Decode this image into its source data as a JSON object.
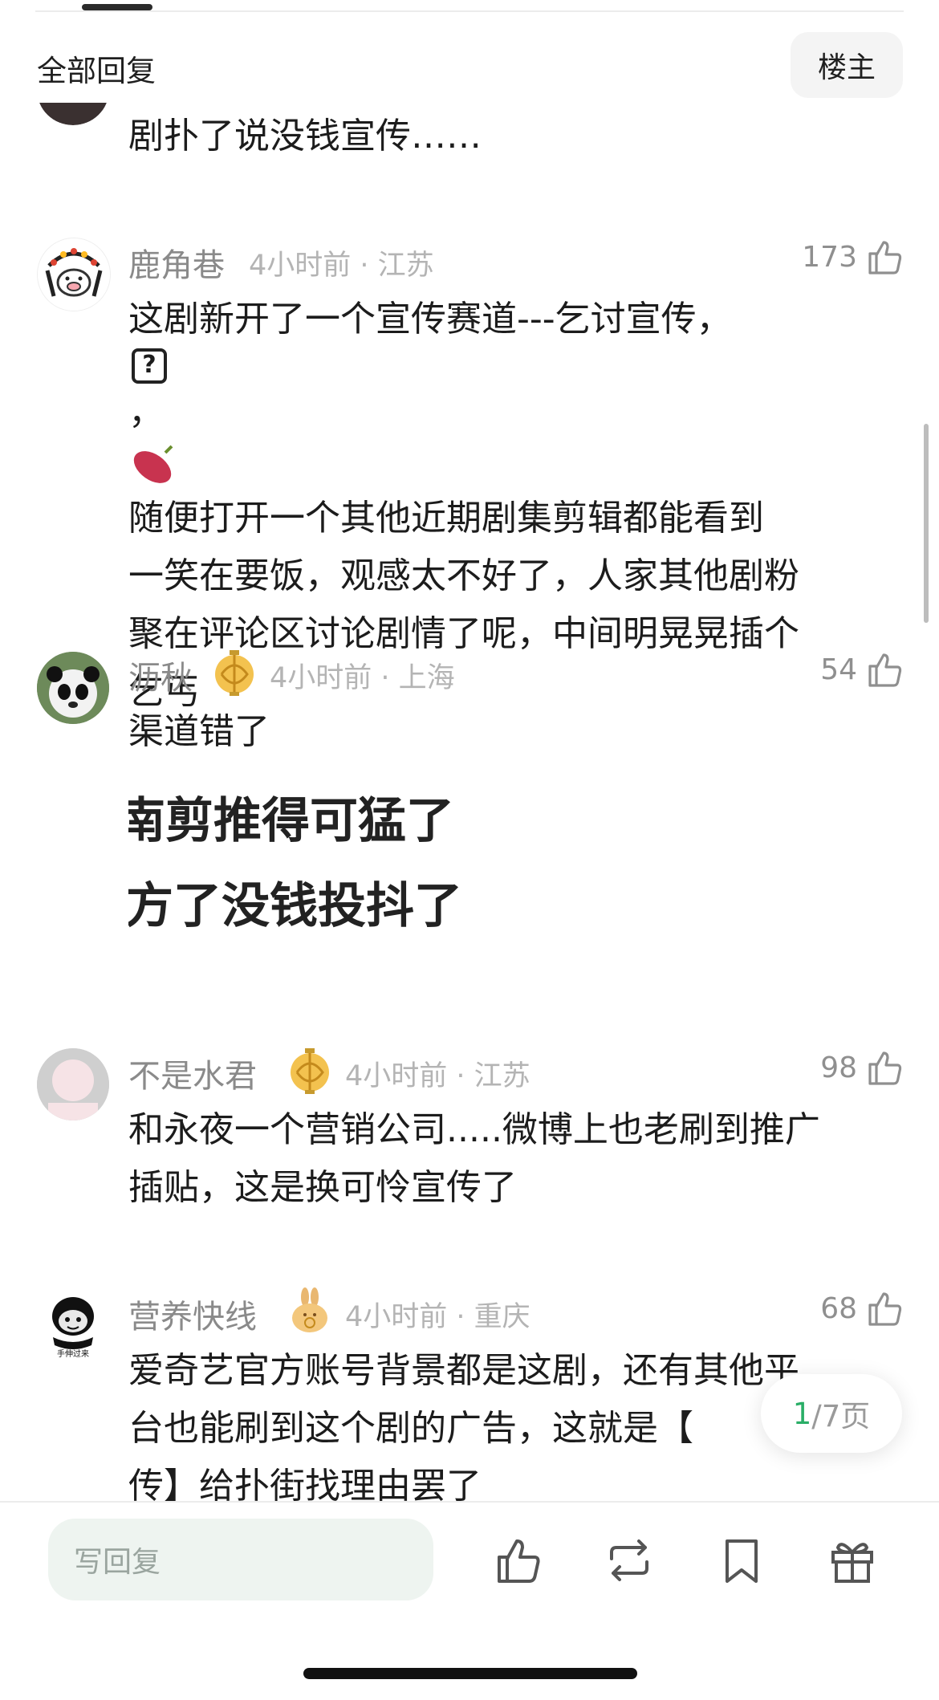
{
  "header": {
    "title": "全部回复",
    "op_button": "楼主"
  },
  "comments": [
    {
      "text_lines": [
        "剧扑了说没钱宣传……"
      ]
    },
    {
      "username": "鹿角巷",
      "meta": "4小时前 · 江苏",
      "likes": "173",
      "line1": "这剧新开了一个宣传赛道---乞讨宣传，",
      "line1_tail": "，",
      "line2": "随便打开一个其他近期剧集剪辑都能看到",
      "line3": "一笑在要饭，观感太不好了，人家其他剧粉",
      "line4": "聚在评论区讨论剧情了呢，中间明晃晃插个",
      "line5": "乞丐"
    },
    {
      "username": "沥秋",
      "meta": "4小时前 · 上海",
      "likes": "54",
      "text": "渠道错了",
      "image_line1": "南剪推得可猛了",
      "image_line2": "方了没钱投抖了"
    },
    {
      "username": "不是水君",
      "meta": "4小时前 · 江苏",
      "likes": "98",
      "text_lines": [
        "和永夜一个营销公司.....微博上也老刷到推广",
        "插贴，这是换可怜宣传了"
      ]
    },
    {
      "username": "营养快线",
      "meta": "4小时前 · 重庆",
      "likes": "68",
      "avatar_caption": "手伸过来",
      "text_lines": [
        "爱奇艺官方账号背景都是这剧，还有其他平",
        "台也能刷到这个剧的广告，这就是【",
        "传】给扑街找理由罢了"
      ]
    }
  ],
  "pagination": {
    "current": "1",
    "total": "/7页"
  },
  "bottom_bar": {
    "reply_placeholder": "写回复",
    "icons": [
      "thumbs-up-icon",
      "repost-icon",
      "bookmark-icon",
      "gift-icon"
    ]
  },
  "colors": {
    "accent": "#2aae67",
    "meta_gray": "#b4b4b4",
    "username_gray": "#8a8a8a"
  }
}
